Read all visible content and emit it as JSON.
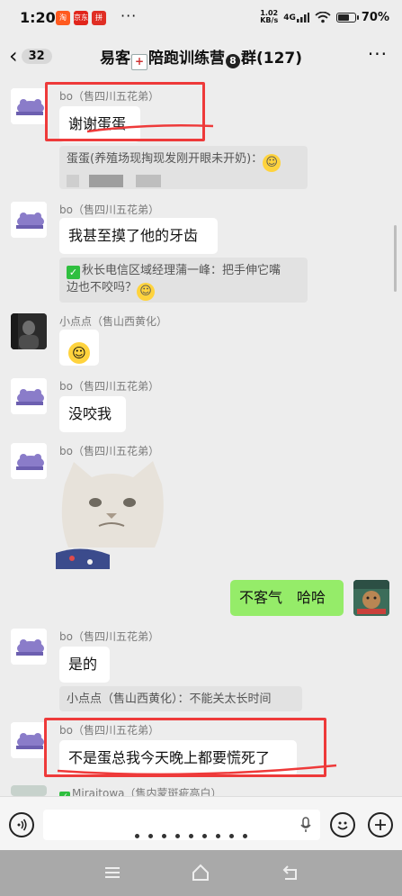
{
  "status": {
    "time": "1:20",
    "apps": [
      {
        "label": "淘",
        "color": "#ff5a1f"
      },
      {
        "label": "京东",
        "color": "#e1251b"
      },
      {
        "label": "拼",
        "color": "#e02e24"
      }
    ],
    "more": "···",
    "net_top": "1.02",
    "net_unit": "KB/s",
    "signal": "4G",
    "battery_text": "70%",
    "battery_level": 0.7
  },
  "header": {
    "unread_count": "32",
    "title_a": "易客",
    "title_b": "陪跑训练营",
    "title_num": "8",
    "title_c": "群(127)",
    "menu_label": "···"
  },
  "messages": {
    "m1": {
      "sender": "bo（售四川五花弟）",
      "text": "谢谢蛋蛋"
    },
    "q1": {
      "text": "蛋蛋(养殖场现掏现发刚开眼未开奶)："
    },
    "m2": {
      "sender": "bo（售四川五花弟）",
      "text": "我甚至摸了他的牙齿"
    },
    "q2": {
      "line1": "秋长电信区域经理蒲一峰：把手伸它嘴",
      "line2": "边也不咬吗？"
    },
    "m3": {
      "sender": "小点点（售山西黄化）"
    },
    "m4": {
      "sender": "bo（售四川五花弟）",
      "text": "没咬我"
    },
    "m5": {
      "sender": "bo（售四川五花弟）"
    },
    "m6": {
      "text": "不客气　哈哈"
    },
    "m7": {
      "sender": "bo（售四川五花弟）",
      "text": "是的"
    },
    "q3": {
      "text": "小点点（售山西黄化）：不能关太长时间"
    },
    "m8": {
      "sender": "bo（售四川五花弟）",
      "text": "不是蛋总我今天晚上都要慌死了"
    },
    "m9": {
      "sender": "Miraitowa（售内蒙斑疵高白）"
    }
  },
  "colors": {
    "background": "#ededed",
    "bubble_self": "#95ec69",
    "bubble_other": "#ffffff",
    "highlight": "#ee3a3a"
  },
  "icons": {
    "back": "chevron-left-icon",
    "menu": "more-dots-icon",
    "voice": "voice-icon",
    "emoji": "emoji-icon",
    "add": "plus-icon",
    "mic": "mic-icon"
  }
}
